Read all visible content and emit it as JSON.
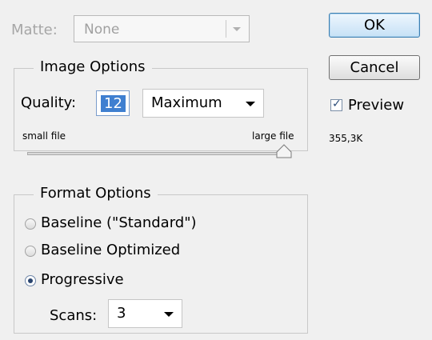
{
  "matte": {
    "label": "Matte:",
    "value": "None"
  },
  "image_options": {
    "title": "Image Options",
    "quality_label": "Quality:",
    "quality_value": "12",
    "quality_preset": "Maximum",
    "small_label": "small file",
    "large_label": "large file",
    "slider_value": 1.0
  },
  "format_options": {
    "title": "Format Options",
    "options": [
      {
        "label": "Baseline (\"Standard\")",
        "selected": false
      },
      {
        "label": "Baseline Optimized",
        "selected": false
      },
      {
        "label": "Progressive",
        "selected": true
      }
    ],
    "scans_label": "Scans:",
    "scans_value": "3"
  },
  "buttons": {
    "ok": "OK",
    "cancel": "Cancel"
  },
  "preview": {
    "label": "Preview",
    "checked": true
  },
  "file_size": "355,3K",
  "colors": {
    "ok_border": "#3c7fb1",
    "selection": "#3f7fd0"
  }
}
